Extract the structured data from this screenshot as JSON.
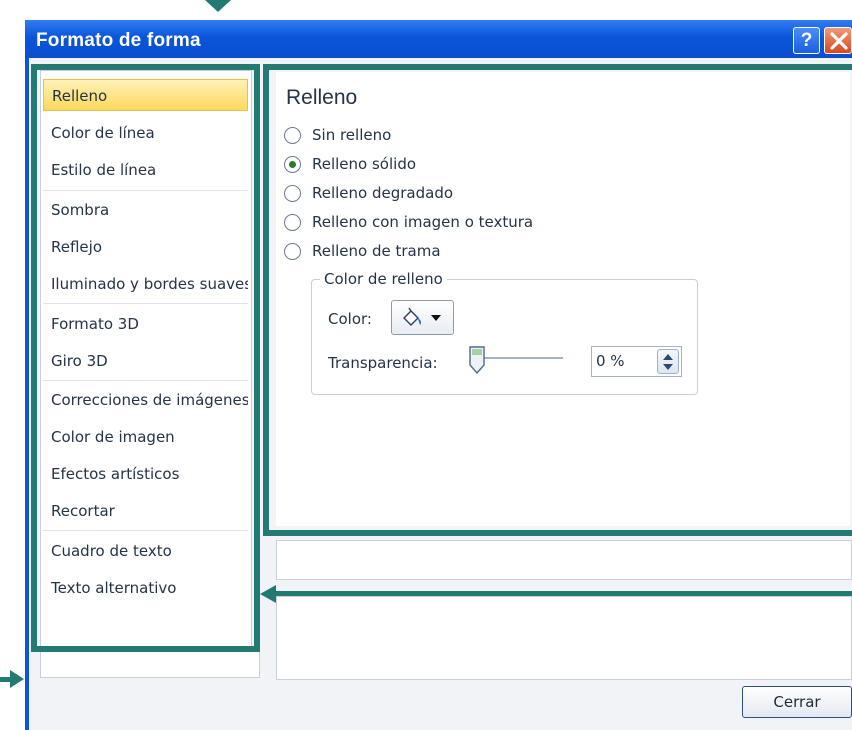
{
  "window": {
    "title": "Formato de forma",
    "help_label": "?"
  },
  "nav": {
    "items": [
      {
        "label": "Relleno"
      },
      {
        "label": "Color de línea"
      },
      {
        "label": "Estilo de línea"
      },
      {
        "label": "Sombra"
      },
      {
        "label": "Reflejo"
      },
      {
        "label": "Iluminado y bordes suaves"
      },
      {
        "label": "Formato 3D"
      },
      {
        "label": "Giro 3D"
      },
      {
        "label": "Correcciones de imágenes"
      },
      {
        "label": "Color de imagen"
      },
      {
        "label": "Efectos artísticos"
      },
      {
        "label": "Recortar"
      },
      {
        "label": "Cuadro de texto"
      },
      {
        "label": "Texto alternativo"
      }
    ],
    "selected": "Relleno"
  },
  "fill": {
    "title": "Relleno",
    "options": [
      {
        "label": "Sin relleno",
        "checked": false
      },
      {
        "label": "Relleno sólido",
        "checked": true
      },
      {
        "label": "Relleno degradado",
        "checked": false
      },
      {
        "label": "Relleno con imagen o textura",
        "checked": false
      },
      {
        "label": "Relleno de trama",
        "checked": false
      }
    ],
    "group_title": "Color de relleno",
    "color_label": "Color:",
    "transparency_label": "Transparencia:",
    "transparency_value": "0 %",
    "transparency_level": 0
  },
  "footer": {
    "close_label": "Cerrar"
  },
  "colors": {
    "titlebar": "#0a55d8",
    "highlight_frame": "#237a73",
    "selected_item": "#ffd95c"
  }
}
